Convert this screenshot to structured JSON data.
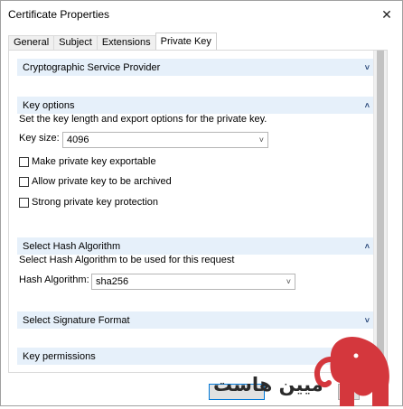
{
  "window": {
    "title": "Certificate Properties",
    "close_glyph": "✕"
  },
  "tabs": [
    {
      "label": "General"
    },
    {
      "label": "Subject"
    },
    {
      "label": "Extensions"
    },
    {
      "label": "Private Key"
    }
  ],
  "sections": {
    "csp": {
      "title": "Cryptographic Service Provider",
      "state": "collapsed"
    },
    "key_options": {
      "title": "Key options",
      "state": "expanded",
      "description": "Set the key length and export options for the private key.",
      "key_size_label": "Key size:",
      "key_size_value": "4096",
      "checkboxes": [
        {
          "label": "Make private key exportable",
          "checked": false
        },
        {
          "label": "Allow private key to be archived",
          "checked": false
        },
        {
          "label": "Strong private key protection",
          "checked": false
        }
      ]
    },
    "hash": {
      "title": "Select Hash Algorithm",
      "state": "expanded",
      "description": "Select Hash Algorithm to be used for this request",
      "label": "Hash Algorithm:",
      "value": "sha256"
    },
    "signature": {
      "title": "Select Signature Format",
      "state": "collapsed"
    },
    "permissions": {
      "title": "Key permissions"
    }
  },
  "watermark": {
    "text": "میین هاست",
    "color": "#d4373d"
  }
}
